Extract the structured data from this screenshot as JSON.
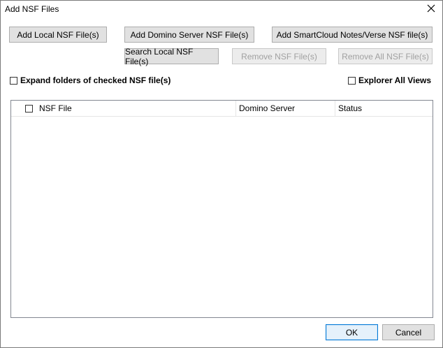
{
  "window": {
    "title": "Add NSF Files"
  },
  "toolbar": {
    "add_local": "Add Local NSF File(s)",
    "add_domino": "Add Domino Server NSF File(s)",
    "add_smartcloud": "Add SmartCloud Notes/Verse NSF file(s)",
    "search_local": "Search Local NSF File(s)",
    "remove": "Remove NSF File(s)",
    "remove_all": "Remove All NSF File(s)"
  },
  "options": {
    "expand_folders": "Expand folders of checked NSF file(s)",
    "explorer_all_views": "Explorer All Views"
  },
  "table": {
    "columns": [
      "NSF File",
      "Domino Server",
      "Status"
    ],
    "rows": []
  },
  "footer": {
    "ok": "OK",
    "cancel": "Cancel"
  },
  "icons": {
    "close": "close-icon"
  }
}
